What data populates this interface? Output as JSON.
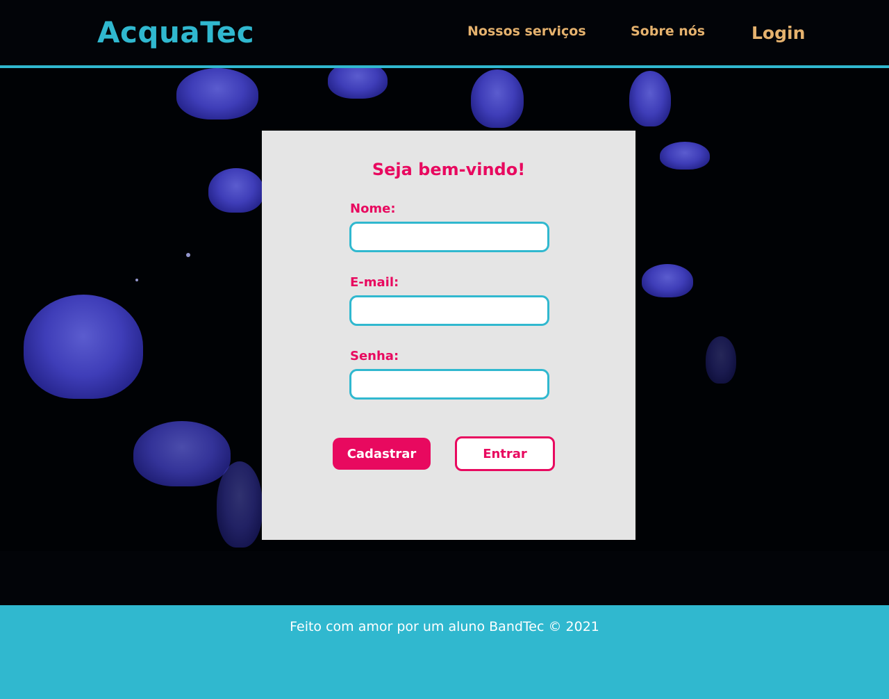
{
  "header": {
    "logo": "AcquaTec",
    "nav": {
      "servicos": "Nossos serviços",
      "sobre": "Sobre nós",
      "login": "Login"
    }
  },
  "form": {
    "title": "Seja bem-vindo!",
    "fields": {
      "nome": {
        "label": "Nome:",
        "value": "",
        "placeholder": ""
      },
      "email": {
        "label": "E-mail:",
        "value": "",
        "placeholder": ""
      },
      "senha": {
        "label": "Senha:",
        "value": "",
        "placeholder": ""
      }
    },
    "buttons": {
      "cadastrar": "Cadastrar",
      "entrar": "Entrar"
    }
  },
  "footer": {
    "text": "Feito com amor por um aluno BandTec © 2021"
  },
  "colors": {
    "brand": "#30b8cf",
    "accent": "#e8095f",
    "nav": "#e5b26e",
    "card_bg": "#e5e5e5"
  }
}
